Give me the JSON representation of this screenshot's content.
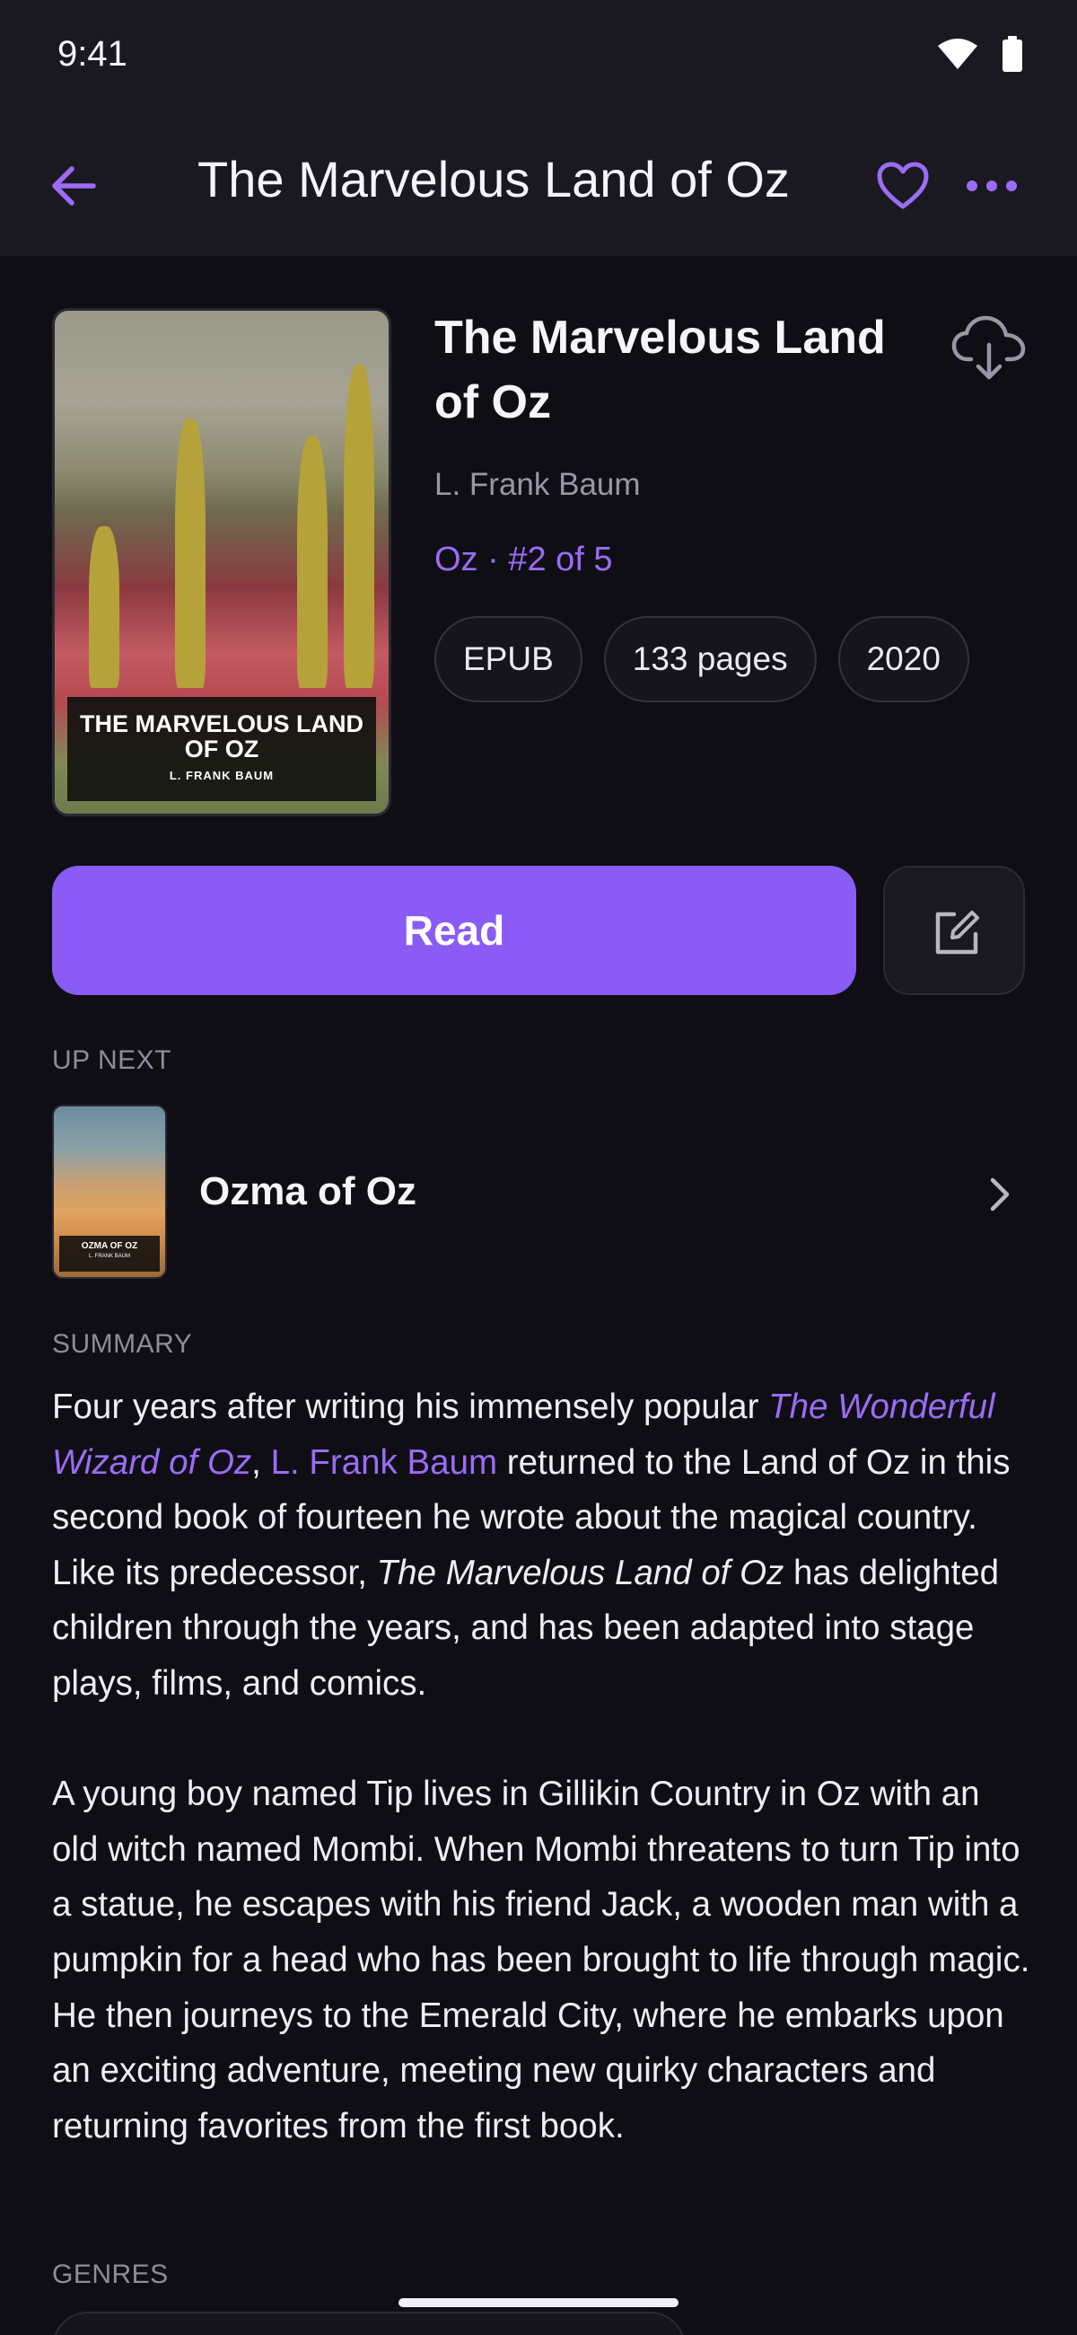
{
  "status_bar": {
    "time": "9:41"
  },
  "app_bar": {
    "title": "The Marvelous Land of Oz"
  },
  "book": {
    "title": "The Marvelous Land of Oz",
    "author": "L. Frank Baum",
    "series": "Oz · #2 of 5",
    "cover_title": "THE MARVELOUS LAND OF OZ",
    "cover_author": "L. FRANK BAUM",
    "chips": [
      "EPUB",
      "133 pages",
      "2020"
    ]
  },
  "actions": {
    "read_label": "Read"
  },
  "up_next": {
    "label": "UP NEXT",
    "title": "Ozma of Oz",
    "cover_title": "OZMA OF OZ",
    "cover_author": "L. FRANK BAUM"
  },
  "summary": {
    "label": "SUMMARY",
    "p1_a": "Four years after writing his immensely popular ",
    "p1_link1": "The Wonderful Wizard of Oz",
    "p1_b": ", ",
    "p1_link2": "L. Frank Baum",
    "p1_c": " returned to the Land of Oz in this second book of fourteen he wrote about the magical country. Like its predecessor, ",
    "p1_italic": "The Marvelous Land of Oz",
    "p1_d": " has delighted children through the years, and has been adapted into stage plays, films, and comics.",
    "p2": "A young boy named Tip lives in Gillikin Country in Oz with an old witch named Mombi. When Mombi threatens to turn Tip into a statue, he escapes with his friend Jack, a wooden man with a pumpkin for a head who has been brought to life through magic. He then journeys to the Emerald City, where he embarks upon an exciting adventure, meeting new quirky characters and returning favorites from the first book."
  },
  "genres": {
    "label": "GENRES"
  },
  "colors": {
    "accent": "#8a5cf5",
    "background": "#0f0e15",
    "surface": "#1a1922"
  },
  "icons": [
    "wifi-icon",
    "battery-icon",
    "back-arrow-icon",
    "heart-icon",
    "more-icon",
    "cloud-download-icon",
    "edit-icon",
    "chevron-right-icon"
  ]
}
